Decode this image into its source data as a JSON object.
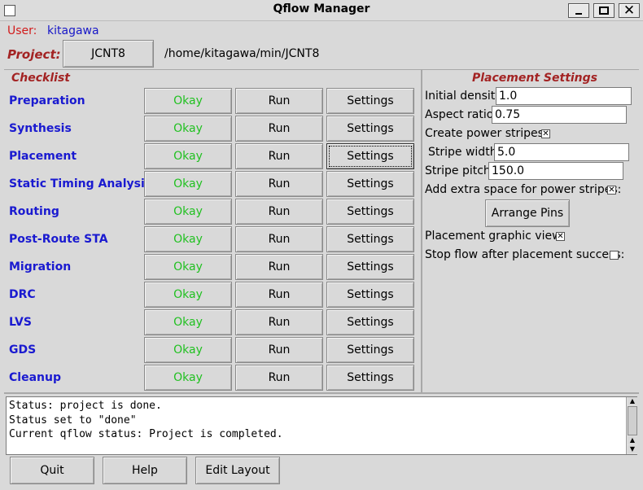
{
  "window": {
    "title": "Qflow Manager"
  },
  "user": {
    "label": "User:",
    "name": "kitagawa"
  },
  "project": {
    "label": "Project:",
    "button": "JCNT8",
    "path": "/home/kitagawa/min/JCNT8"
  },
  "checklist": {
    "heading": "Checklist",
    "rows": [
      {
        "name": "Preparation",
        "status": "Okay",
        "run": "Run",
        "settings": "Settings"
      },
      {
        "name": "Synthesis",
        "status": "Okay",
        "run": "Run",
        "settings": "Settings"
      },
      {
        "name": "Placement",
        "status": "Okay",
        "run": "Run",
        "settings": "Settings"
      },
      {
        "name": "Static Timing Analysis",
        "status": "Okay",
        "run": "Run",
        "settings": "Settings"
      },
      {
        "name": "Routing",
        "status": "Okay",
        "run": "Run",
        "settings": "Settings"
      },
      {
        "name": "Post-Route STA",
        "status": "Okay",
        "run": "Run",
        "settings": "Settings"
      },
      {
        "name": "Migration",
        "status": "Okay",
        "run": "Run",
        "settings": "Settings"
      },
      {
        "name": "DRC",
        "status": "Okay",
        "run": "Run",
        "settings": "Settings"
      },
      {
        "name": "LVS",
        "status": "Okay",
        "run": "Run",
        "settings": "Settings"
      },
      {
        "name": "GDS",
        "status": "Okay",
        "run": "Run",
        "settings": "Settings"
      },
      {
        "name": "Cleanup",
        "status": "Okay",
        "run": "Run",
        "settings": "Settings"
      }
    ]
  },
  "placement": {
    "heading": "Placement Settings",
    "initial_density": {
      "label": "Initial density:",
      "value": "1.0"
    },
    "aspect_ratio": {
      "label": "Aspect ratio:",
      "value": "0.75"
    },
    "power_stripes": {
      "label": "Create power stripes:",
      "checked": true
    },
    "stripe_width": {
      "label": "Stripe width:",
      "value": "5.0"
    },
    "stripe_pitch": {
      "label": "Stripe pitch:",
      "value": "150.0"
    },
    "extra_space": {
      "label": "Add extra space for power stripes:",
      "checked": true
    },
    "arrange_pins": "Arrange Pins",
    "graphic_view": {
      "label": "Placement graphic view:",
      "checked": true
    },
    "stop_flow": {
      "label": "Stop flow after placement success:",
      "checked": false
    }
  },
  "status_lines": [
    "Status: project is done.",
    "Status set to \"done\"",
    "Current qflow status:  Project is completed."
  ],
  "bottom_buttons": {
    "quit": "Quit",
    "help": "Help",
    "edit_layout": "Edit Layout"
  },
  "colors": {
    "step_blue": "#1a1ad0",
    "okay_green": "#21c121",
    "label_red": "#d21b1b",
    "heading_red": "#a32323"
  }
}
